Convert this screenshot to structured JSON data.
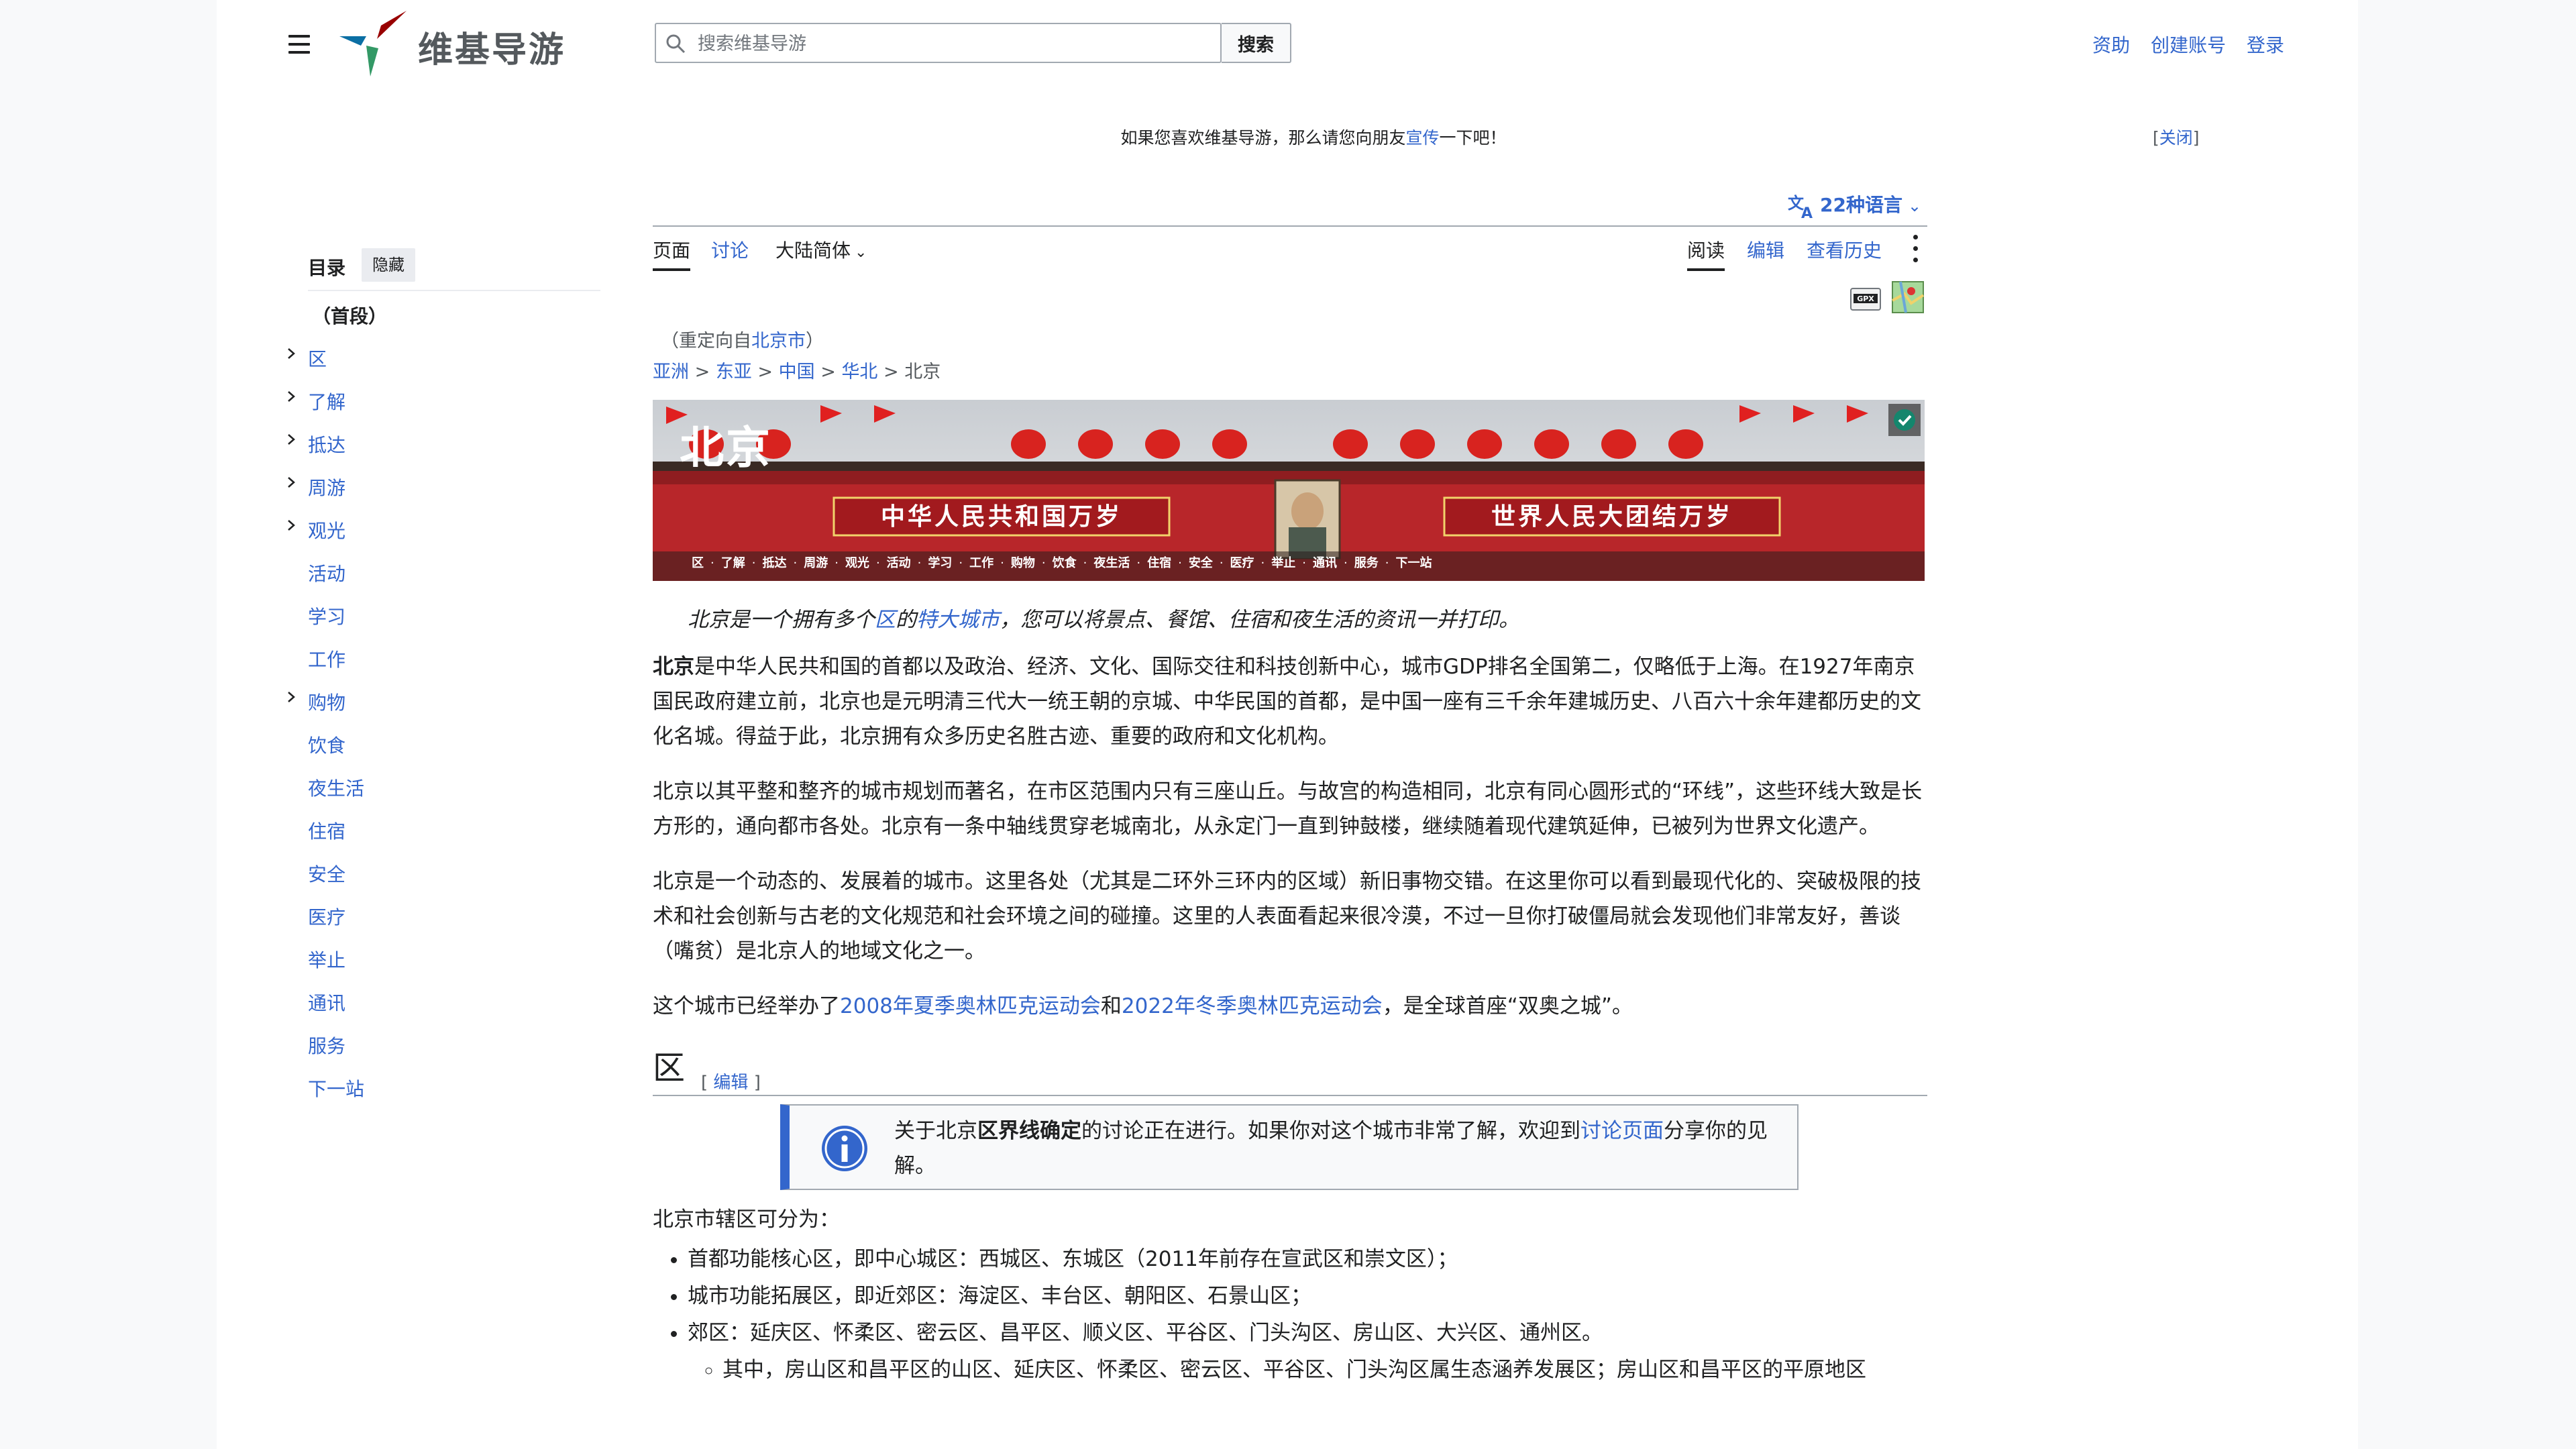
{
  "site": {
    "wordmark": "维基导游",
    "search_placeholder": "搜索维基导游",
    "search_button": "搜索",
    "user_links": [
      "资助",
      "创建账号",
      "登录"
    ]
  },
  "notice": {
    "before": "如果您喜欢维基导游，那么请您向朋友",
    "link": "宣传",
    "after": "一下吧！",
    "close_text": "关闭"
  },
  "languages": {
    "label": "22种语言"
  },
  "tabs": {
    "page": "页面",
    "discussion": "讨论",
    "variant": "大陆简体",
    "read": "阅读",
    "edit": "编辑",
    "history": "查看历史"
  },
  "indicators": {
    "gpx": "GPX"
  },
  "toc": {
    "title": "目录",
    "hide": "隐藏",
    "first": "（首段）",
    "items": [
      {
        "label": "区",
        "expandable": true
      },
      {
        "label": "了解",
        "expandable": true
      },
      {
        "label": "抵达",
        "expandable": true
      },
      {
        "label": "周游",
        "expandable": true
      },
      {
        "label": "观光",
        "expandable": true
      },
      {
        "label": "活动",
        "expandable": false
      },
      {
        "label": "学习",
        "expandable": false
      },
      {
        "label": "工作",
        "expandable": false
      },
      {
        "label": "购物",
        "expandable": true
      },
      {
        "label": "饮食",
        "expandable": false
      },
      {
        "label": "夜生活",
        "expandable": false
      },
      {
        "label": "住宿",
        "expandable": false
      },
      {
        "label": "安全",
        "expandable": false
      },
      {
        "label": "医疗",
        "expandable": false
      },
      {
        "label": "举止",
        "expandable": false
      },
      {
        "label": "通讯",
        "expandable": false
      },
      {
        "label": "服务",
        "expandable": false
      },
      {
        "label": "下一站",
        "expandable": false
      }
    ]
  },
  "redirect": {
    "before": "（重定向自",
    "link": "北京市",
    "after": "）"
  },
  "breadcrumb": {
    "items": [
      "亚洲",
      "东亚",
      "中国",
      "华北"
    ],
    "separator": ">",
    "current": "北京"
  },
  "banner": {
    "title": "北京",
    "slogan_left": "中华人民共和国万岁",
    "slogan_right": "世界人民大团结万岁",
    "nav": [
      "区",
      "了解",
      "抵达",
      "周游",
      "观光",
      "活动",
      "学习",
      "工作",
      "购物",
      "饮食",
      "夜生活",
      "住宿",
      "安全",
      "医疗",
      "举止",
      "通讯",
      "服务",
      "下一站"
    ]
  },
  "intro": {
    "p1": "北京是一个拥有多个",
    "link1": "区",
    "p2": "的",
    "link2": "特大城市",
    "p3": "，您可以将景点、餐馆、住宿和夜生活的资讯一并打印。"
  },
  "paragraphs": {
    "p1_bold": "北京",
    "p1_rest": "是中华人民共和国的首都以及政治、经济、文化、国际交往和科技创新中心，城市GDP排名全国第二，仅略低于上海。在1927年南京国民政府建立前，北京也是元明清三代大一统王朝的京城、中华民国的首都，是中国一座有三千余年建城历史、八百六十余年建都历史的文化名城。得益于此，北京拥有众多历史名胜古迹、重要的政府和文化机构。",
    "p2": "北京以其平整和整齐的城市规划而著名，在市区范围内只有三座山丘。与故宫的构造相同，北京有同心圆形式的“环线”，这些环线大致是长方形的，通向都市各处。北京有一条中轴线贯穿老城南北，从永定门一直到钟鼓楼，继续随着现代建筑延伸，已被列为世界文化遗产。",
    "p3": "北京是一个动态的、发展着的城市。这里各处（尤其是二环外三环内的区域）新旧事物交错。在这里你可以看到最现代化的、突破极限的技术和社会创新与古老的文化规范和社会环境之间的碰撞。这里的人表面看起来很冷漠，不过一旦你打破僵局就会发现他们非常友好，善谈（嘴贫）是北京人的地域文化之一。",
    "p4_before": "这个城市已经举办了",
    "p4_link1": "2008年夏季奥林匹克运动会",
    "p4_mid": "和",
    "p4_link2": "2022年冬季奥林匹克运动会",
    "p4_after": "，是全球首座“双奥之城”。"
  },
  "section": {
    "title": "区",
    "edit_open": "[",
    "edit": "编辑",
    "edit_close": "]"
  },
  "ambox": {
    "t1": "关于北京",
    "t2": "区界线确定",
    "t3": "的讨论正在进行。如果你对这个城市非常了解，欢迎到",
    "link": "讨论页面",
    "t4": "分享你的见解。"
  },
  "districts": {
    "intro": "北京市辖区可分为：",
    "items": [
      "首都功能核心区，即中心城区：西城区、东城区（2011年前存在宣武区和崇文区）；",
      "城市功能拓展区，即近郊区：海淀区、丰台区、朝阳区、石景山区；",
      "郊区：延庆区、怀柔区、密云区、昌平区、顺义区、平谷区、门头沟区、房山区、大兴区、通州区。"
    ],
    "sub_item": "其中，房山区和昌平区的山区、延庆区、怀柔区、密云区、平谷区、门头沟区属生态涵养发展区；房山区和昌平区的平原地区"
  },
  "colors": {
    "link": "#3366cc",
    "text": "#202122",
    "ambox_bar": "#3366cc",
    "banner_red": "#b8262a"
  }
}
